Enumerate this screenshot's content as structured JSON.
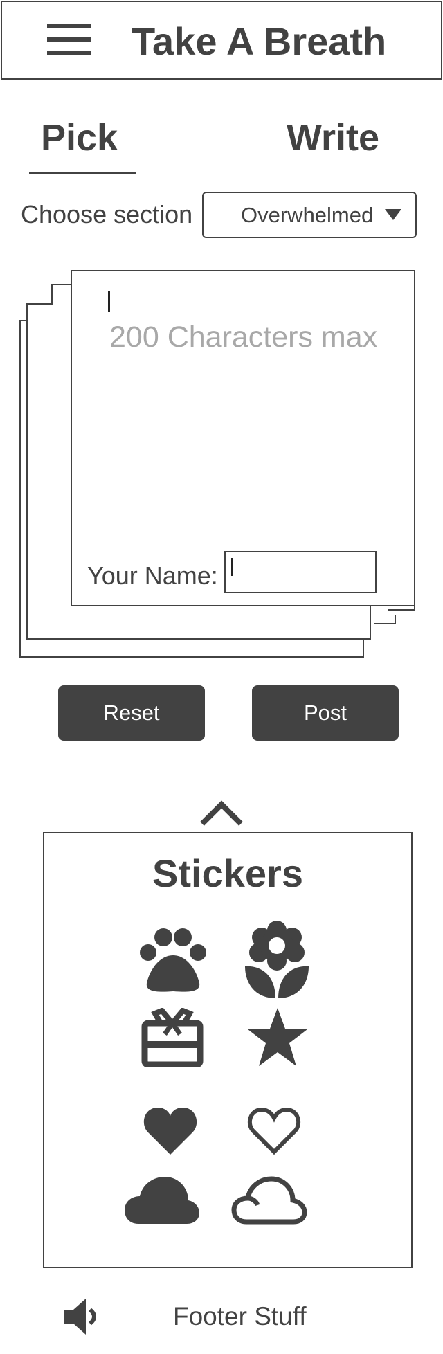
{
  "header": {
    "menu_icon": "hamburger-menu-icon",
    "title": "Take A Breath"
  },
  "tabs": [
    {
      "label": "Pick",
      "active": true
    },
    {
      "label": "Write",
      "active": false
    }
  ],
  "section": {
    "label": "Choose section",
    "selected": "Overwhelmed",
    "icon": "caret-down-icon"
  },
  "note": {
    "placeholder": "200 Characters max",
    "name_label": "Your Name:",
    "name_value": ""
  },
  "actions": {
    "reset_label": "Reset",
    "post_label": "Post"
  },
  "stickers": {
    "toggle_icon": "chevron-up-icon",
    "title": "Stickers",
    "items": [
      {
        "icon": "paw-icon"
      },
      {
        "icon": "flower-icon"
      },
      {
        "icon": "gift-icon"
      },
      {
        "icon": "star-icon"
      },
      {
        "icon": "heart-filled-icon"
      },
      {
        "icon": "heart-outline-icon"
      },
      {
        "icon": "cloud-filled-icon"
      },
      {
        "icon": "cloud-outline-icon"
      }
    ]
  },
  "footer": {
    "sound_icon": "speaker-icon",
    "text": "Footer Stuff"
  },
  "colors": {
    "ink": "#424242",
    "placeholder": "#a8a8a8",
    "background": "#ffffff"
  }
}
